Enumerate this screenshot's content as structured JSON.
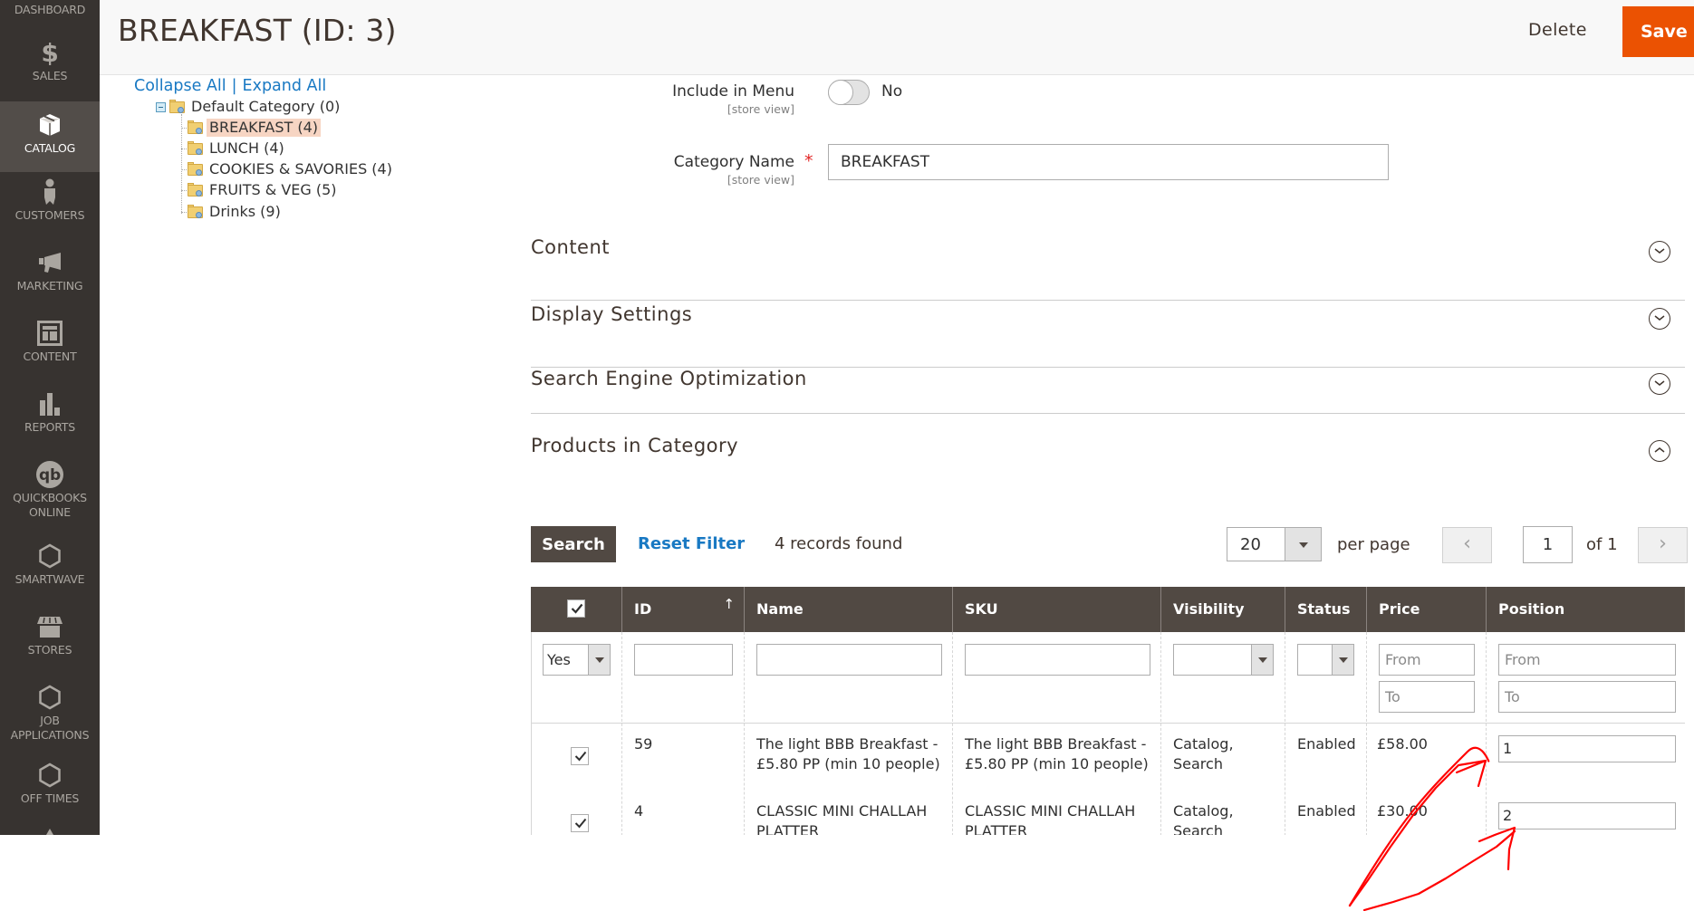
{
  "sidebar": {
    "items": [
      {
        "label": "DASHBOARD",
        "icon": "dashboard-icon"
      },
      {
        "label": "SALES",
        "icon": "dollar-icon"
      },
      {
        "label": "CATALOG",
        "icon": "box-icon",
        "active": true
      },
      {
        "label": "CUSTOMERS",
        "icon": "person-icon"
      },
      {
        "label": "MARKETING",
        "icon": "megaphone-icon"
      },
      {
        "label": "CONTENT",
        "icon": "layout-icon"
      },
      {
        "label": "REPORTS",
        "icon": "bar-chart-icon"
      },
      {
        "label": "QUICKBOOKS ONLINE",
        "line1": "QUICKBOOKS",
        "line2": "ONLINE",
        "icon": "quickbooks-icon"
      },
      {
        "label": "SMARTWAVE",
        "icon": "hexagon-icon"
      },
      {
        "label": "STORES",
        "icon": "store-icon"
      },
      {
        "label": "JOB APPLICATIONS",
        "line1": "JOB",
        "line2": "APPLICATIONS",
        "icon": "hexagon-icon"
      },
      {
        "label": "OFF TIMES",
        "icon": "hexagon-icon"
      }
    ]
  },
  "header": {
    "title": "BREAKFAST (ID: 3)",
    "delete_label": "Delete",
    "save_label": "Save",
    "save_color": "#eb5202"
  },
  "tree": {
    "collapse_all": "Collapse All",
    "separator": "|",
    "expand_all": "Expand All",
    "root": "Default Category (0)",
    "children": [
      {
        "label": "BREAKFAST (4)",
        "selected": true
      },
      {
        "label": "LUNCH (4)"
      },
      {
        "label": "COOKIES & SAVORIES (4)"
      },
      {
        "label": "FRUITS & VEG (5)"
      },
      {
        "label": "Drinks (9)"
      }
    ]
  },
  "form": {
    "include_in_menu": {
      "label": "Include in Menu",
      "scope": "[store view]",
      "value": "No"
    },
    "category_name": {
      "label": "Category Name",
      "scope": "[store view]",
      "required_mark": "*",
      "value": "BREAKFAST"
    }
  },
  "sections": [
    {
      "title": "Content",
      "expanded": false
    },
    {
      "title": "Display Settings",
      "expanded": false
    },
    {
      "title": "Search Engine Optimization",
      "expanded": false
    },
    {
      "title": "Products in Category",
      "expanded": true
    }
  ],
  "grid": {
    "search_label": "Search",
    "reset_filter_label": "Reset Filter",
    "records_found": "4 records found",
    "per_page_value": "20",
    "per_page_label": "per page",
    "prev_label": "‹",
    "next_label": "›",
    "current_page": "1",
    "page_of": "of 1",
    "columns": [
      "",
      "ID",
      "Name",
      "SKU",
      "Visibility",
      "Status",
      "Price",
      "Position"
    ],
    "sort_indicator": "↑",
    "filters": {
      "in_category": "Yes",
      "price_from_placeholder": "From",
      "price_to_placeholder": "To",
      "position_from_placeholder": "From",
      "position_to_placeholder": "To"
    },
    "rows": [
      {
        "checked": true,
        "id": "59",
        "name_line1": "The light BBB Breakfast -",
        "name_line2": "£5.80 PP (min 10 people)",
        "sku_line1": "The light BBB Breakfast -",
        "sku_line2": "£5.80 PP (min 10 people)",
        "visibility_line1": "Catalog,",
        "visibility_line2": "Search",
        "status": "Enabled",
        "price": "£58.00",
        "position": "1"
      },
      {
        "checked": true,
        "id": "4",
        "name_line1": "CLASSIC MINI CHALLAH",
        "name_line2": "PLATTER",
        "sku_line1": "CLASSIC MINI CHALLAH",
        "sku_line2": "PLATTER",
        "visibility_line1": "Catalog,",
        "visibility_line2": "Search",
        "status": "Enabled",
        "price": "£30.00",
        "position": "2"
      }
    ]
  },
  "annotation": {
    "color": "#ff0000",
    "description": "hand-drawn red arrows pointing at Position inputs"
  }
}
